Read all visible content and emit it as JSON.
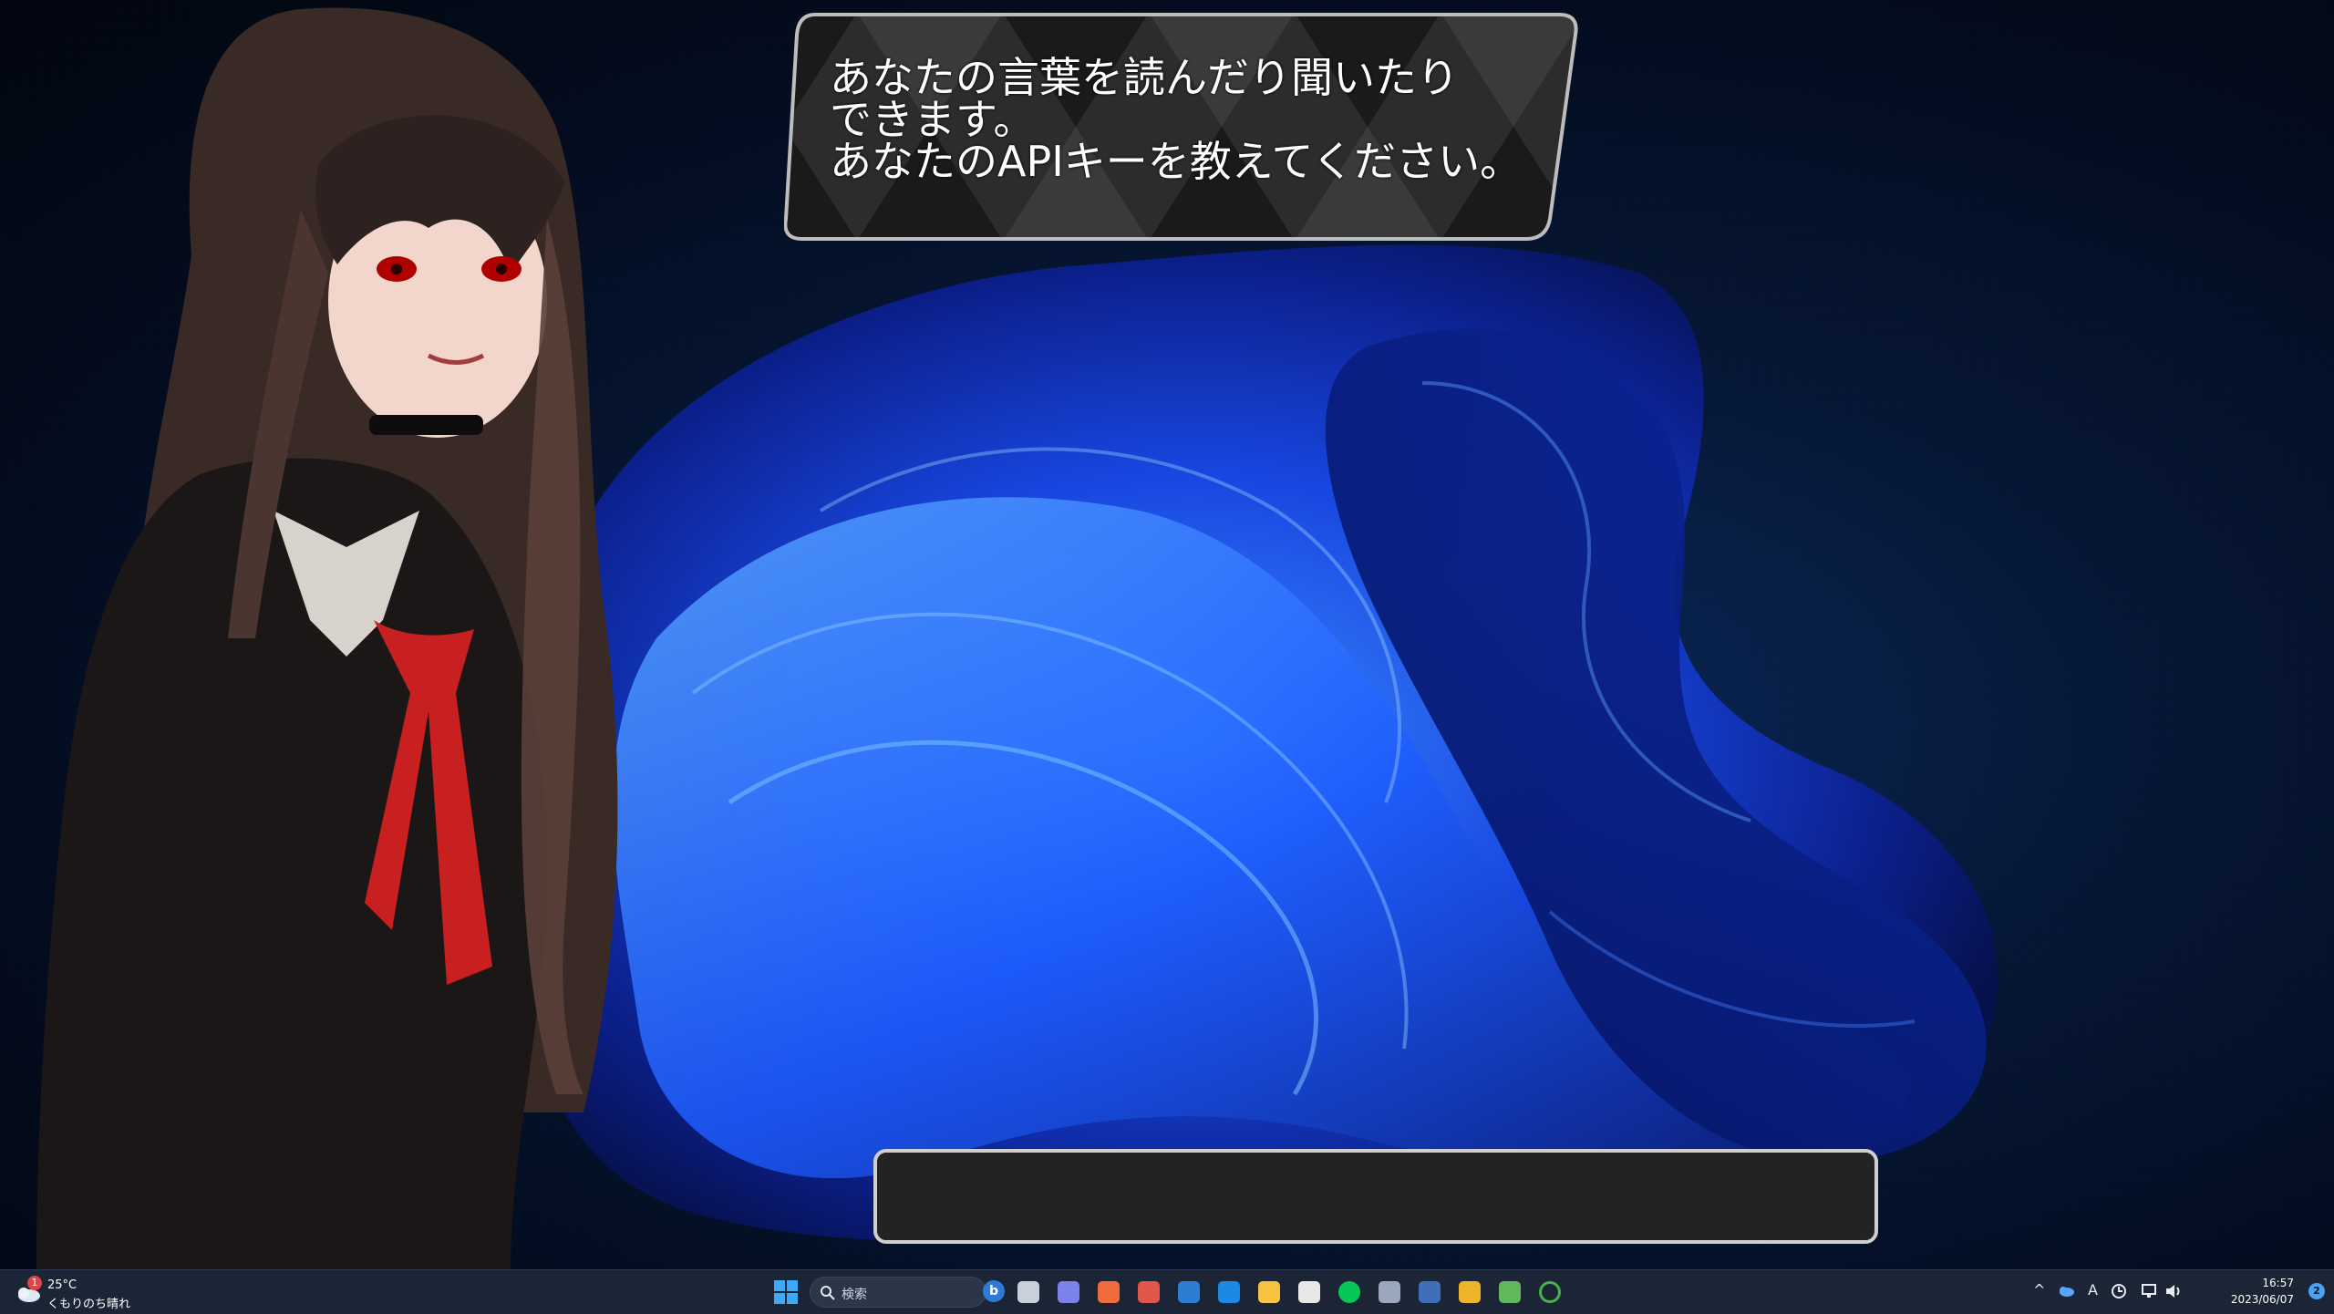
{
  "speech": {
    "lines": [
      "あなたの言葉を読んだり聞いたり",
      "できます。",
      "あなたのAPIキーを教えてください。"
    ]
  },
  "input": {
    "value": ""
  },
  "taskbar": {
    "weather": {
      "badge": "1",
      "temp": "25°C",
      "condition": "くもりのち晴れ",
      "icon": "cloud-sun-icon"
    },
    "search_label": "検索",
    "bing_label": "b",
    "apps": [
      {
        "name": "task-view",
        "icon": "task-view-icon",
        "color": "#c8d0dc"
      },
      {
        "name": "teams-chat",
        "icon": "teams-icon",
        "color": "#7b83eb"
      },
      {
        "name": "brave",
        "icon": "brave-lion-icon",
        "color": "#f26b3a"
      },
      {
        "name": "brave-beta",
        "icon": "brave-beta-icon",
        "color": "#e2574c"
      },
      {
        "name": "store",
        "icon": "store-icon",
        "color": "#2d7dd2"
      },
      {
        "name": "mail",
        "icon": "mail-icon",
        "color": "#1e88e5"
      },
      {
        "name": "file-explorer",
        "icon": "folder-icon",
        "color": "#f6c343"
      },
      {
        "name": "slack",
        "icon": "slack-icon",
        "color": "#e8e8e8"
      },
      {
        "name": "line",
        "icon": "line-icon",
        "color": "#06c755"
      },
      {
        "name": "settings",
        "icon": "gear-icon",
        "color": "#9aa7bd"
      },
      {
        "name": "xi-app",
        "icon": "xi-icon",
        "color": "#3e6fb8"
      },
      {
        "name": "paint",
        "icon": "paint-icon",
        "color": "#f0b429"
      },
      {
        "name": "vim",
        "icon": "vim-icon",
        "color": "#5fb85c"
      },
      {
        "name": "loading",
        "icon": "ring-icon",
        "color": "#4caf50"
      }
    ],
    "tray": {
      "chevron": "^",
      "ime": "A",
      "time": "16:57",
      "date": "2023/06/07",
      "notification_badge": "2"
    }
  }
}
